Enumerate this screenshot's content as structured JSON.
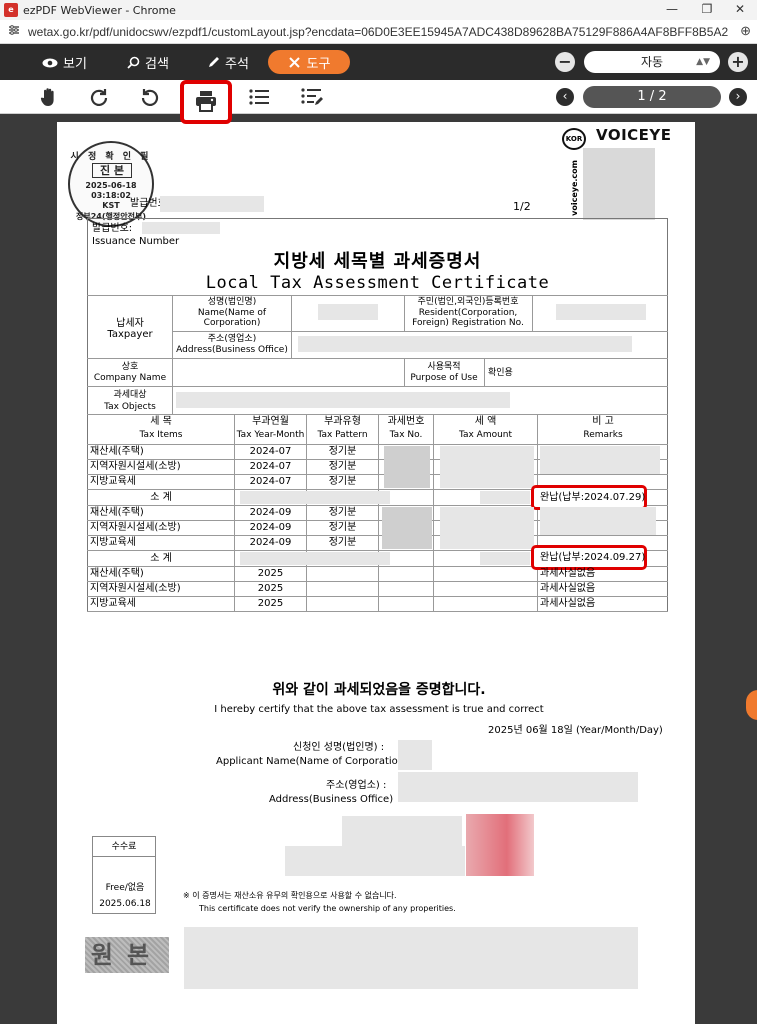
{
  "window": {
    "title": "ezPDF WebViewer - Chrome",
    "minimize": "—",
    "restore": "❐",
    "close": "✕"
  },
  "browser": {
    "url": "wetax.go.kr/pdf/unidocswv/ezpdf1/customLayout.jsp?encdata=06D0E3EE15945A7ADC438D89628BA75129F886A4AF8BFF8B5A24B1162946...",
    "zoom_icon": "⊕"
  },
  "toolbar": {
    "view_label": "보기",
    "search_label": "검색",
    "annotate_label": "주석",
    "tools_label": "도구",
    "zoom_value": "자동",
    "zoom_out": "−",
    "zoom_in": "+"
  },
  "toolbar2": {
    "page_indicator": "1 / 2",
    "prev": "‹",
    "next": "›"
  },
  "seal": {
    "ring": "시 정 확 인 필",
    "center": "진 본",
    "date": "2025-06-18",
    "time": "03:18:02",
    "tz": "KST",
    "org": "정부24(행정안전부)"
  },
  "voiceye": {
    "brand": "VOICEYE",
    "kor": "KOR",
    "site": "voiceye.com"
  },
  "doc": {
    "issue_label_top": "발급번호",
    "page_of": "1/2",
    "issue_label_ko": "발급번호:",
    "issue_label_en": "Issuance Number",
    "title_ko": "지방세 세목별 과세증명서",
    "title_en": "Local Tax Assessment Certificate",
    "taxpayer_ko": "납세자",
    "taxpayer_en": "Taxpayer",
    "name_ko": "성명(법인명)",
    "name_en1": "Name(Name of",
    "name_en2": "Corporation)",
    "resident_ko": "주민(법인,외국인)등록번호",
    "resident_en1": "Resident(Corporation,",
    "resident_en2": "Foreign) Registration No.",
    "address_ko": "주소(영업소)",
    "address_en": "Address(Business Office)",
    "company_ko": "상호",
    "company_en": "Company Name",
    "purpose_ko": "사용목적",
    "purpose_en": "Purpose of Use",
    "purpose_val": "확인용",
    "objects_ko": "과세대상",
    "objects_en": "Tax Objects",
    "col_items_ko": "세        목",
    "col_items_en": "Tax Items",
    "col_year_ko": "부과연월",
    "col_year_en": "Tax Year-Month",
    "col_pattern_ko": "부과유형",
    "col_pattern_en": "Tax Pattern",
    "col_no_ko": "과세번호",
    "col_no_en": "Tax No.",
    "col_amount_ko": "세      액",
    "col_amount_en": "Tax Amount",
    "col_remarks_ko": "비      고",
    "col_remarks_en": "Remarks",
    "rows": [
      {
        "item": "재산세(주택)",
        "ym": "2024-07",
        "pattern": "정기분"
      },
      {
        "item": "지역자원시설세(소방)",
        "ym": "2024-07",
        "pattern": "정기분"
      },
      {
        "item": "지방교육세",
        "ym": "2024-07",
        "pattern": "정기분"
      },
      {
        "item": "재산세(주택)",
        "ym": "2024-09",
        "pattern": "정기분"
      },
      {
        "item": "지역자원시설세(소방)",
        "ym": "2024-09",
        "pattern": "정기분"
      },
      {
        "item": "지방교육세",
        "ym": "2024-09",
        "pattern": "정기분"
      },
      {
        "item": "재산세(주택)",
        "ym": "2025",
        "remark": "과세사실없음"
      },
      {
        "item": "지역자원시설세(소방)",
        "ym": "2025",
        "remark": "과세사실없음"
      },
      {
        "item": "지방교육세",
        "ym": "2025",
        "remark": "과세사실없음"
      }
    ],
    "subtotal_label": "소    계",
    "paid1": "완납(납부:2024.07.29)",
    "paid2": "완납(납부:2024.09.27)",
    "cert_ko": "위와 같이 과세되었음을 증명합니다.",
    "cert_en": "I hereby certify that the above tax assessment is true and correct",
    "date_line": "2025년 06월 18일 (Year/Month/Day)",
    "applicant_ko": "신청인 성명(법인명) :",
    "applicant_en": "Applicant Name(Name of Corporation)",
    "app_addr_ko": "주소(영업소) :",
    "app_addr_en": "Address(Business Office)",
    "fee_label": "수수료",
    "fee_val": "Free/없음",
    "fee_date": "2025.06.18",
    "note_ko": "※ 이 증명서는 재산소유 유무의 확인용으로 사용할 수 없습니다.",
    "note_en": "This certificate does not verify the ownership of any properities.",
    "wonbon": "원본"
  }
}
